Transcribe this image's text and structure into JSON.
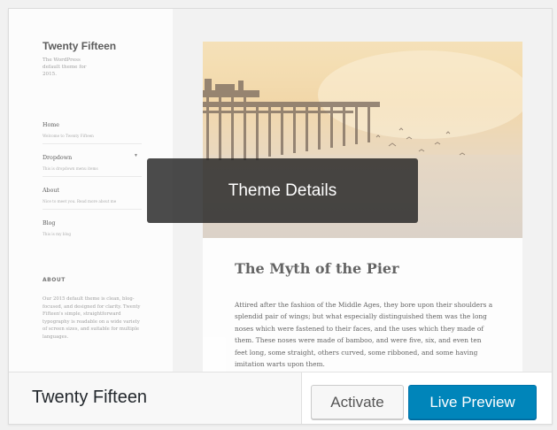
{
  "theme": {
    "name": "Twenty Fifteen"
  },
  "preview": {
    "sidebar": {
      "site_title": "Twenty Fifteen",
      "site_description": "The WordPress default theme for 2015.",
      "menu": [
        {
          "label": "Home",
          "sub": "Welcome to Twenty Fifteen",
          "has_caret": false
        },
        {
          "label": "Dropdown",
          "sub": "This is dropdown menu items",
          "has_caret": true
        },
        {
          "label": "About",
          "sub": "Nice to meet you. Read more about me",
          "has_caret": false
        },
        {
          "label": "Blog",
          "sub": "This is my blog",
          "has_caret": false
        }
      ],
      "widget_title": "ABOUT",
      "widget_text": "Our 2015 default theme is clean, blog-focused, and designed for clarity. Twenty Fifteen's simple, straightforward typography is readable on a wide variety of screen sizes, and suitable for multiple languages."
    },
    "post": {
      "title": "The Myth of the Pier",
      "body": "Attired after the fashion of the Middle Ages, they bore upon their shoulders a splendid pair of wings; but what especially distinguished them was the long noses which were fastened to their faces, and the uses which they made of them. These noses were made of bamboo, and were five, six, and even ten feet long, some straight, others curved, some ribboned, and some having imitation warts upon them."
    }
  },
  "overlay": {
    "label": "Theme Details"
  },
  "actions": {
    "activate_label": "Activate",
    "live_preview_label": "Live Preview"
  },
  "colors": {
    "primary": "#0085ba",
    "overlay": "#232323"
  }
}
